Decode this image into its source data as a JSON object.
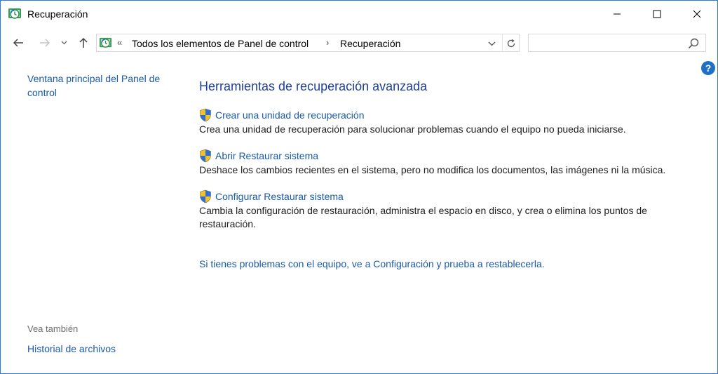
{
  "window": {
    "title": "Recuperación",
    "icon": "recovery-icon"
  },
  "nav": {
    "back_icon": "arrow-left-icon",
    "forward_icon": "arrow-right-icon",
    "recent_icon": "chevron-down-icon",
    "up_icon": "arrow-up-icon"
  },
  "address": {
    "overflow": "«",
    "crumbs": [
      "Todos los elementos de Panel de control",
      "Recuperación"
    ],
    "separator": "›"
  },
  "search": {
    "placeholder": ""
  },
  "left": {
    "home_link": "Ventana principal del Panel de control",
    "see_also_label": "Vea también",
    "see_also_items": [
      "Historial de archivos"
    ]
  },
  "main": {
    "heading": "Herramientas de recuperación avanzada",
    "tasks": [
      {
        "label": "Crear una unidad de recuperación",
        "description": "Crea una unidad de recuperación para solucionar problemas cuando el equipo no pueda iniciarse."
      },
      {
        "label": "Abrir Restaurar sistema",
        "description": "Deshace los cambios recientes en el sistema, pero no modifica los documentos, las imágenes ni la música."
      },
      {
        "label": "Configurar Restaurar sistema",
        "description": "Cambia la configuración de restauración, administra el espacio en disco, y crea o elimina los puntos de restauración."
      }
    ],
    "bottom_link": "Si tienes problemas con el equipo, ve a Configuración y prueba a restablecerla."
  },
  "colors": {
    "link": "#1a5aa6",
    "heading": "#1e3f9b",
    "help": "#1f6fc5"
  }
}
